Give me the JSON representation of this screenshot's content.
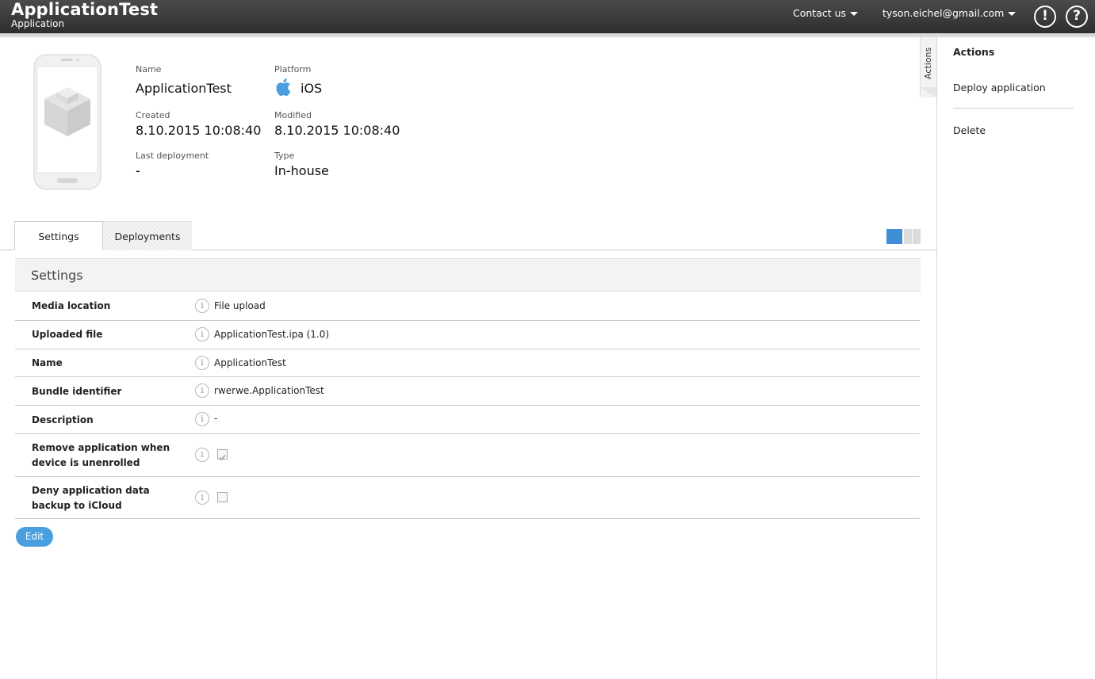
{
  "header": {
    "title": "ApplicationTest",
    "subtitle": "Application",
    "contact_label": "Contact us",
    "user_email": "tyson.eichel@gmail.com",
    "alert_symbol": "!",
    "help_symbol": "?"
  },
  "app_info": {
    "name_label": "Name",
    "name_value": "ApplicationTest",
    "platform_label": "Platform",
    "platform_value": "iOS",
    "platform_icon": "apple-icon",
    "created_label": "Created",
    "created_value": "8.10.2015 10:08:40",
    "modified_label": "Modified",
    "modified_value": "8.10.2015 10:08:40",
    "last_deployment_label": "Last deployment",
    "last_deployment_value": "-",
    "type_label": "Type",
    "type_value": "In-house"
  },
  "tabs": [
    {
      "label": "Settings",
      "active": true
    },
    {
      "label": "Deployments",
      "active": false
    }
  ],
  "settings": {
    "title": "Settings",
    "rows": [
      {
        "label": "Media location",
        "value": "File upload"
      },
      {
        "label": "Uploaded file",
        "value": "ApplicationTest.ipa (1.0)"
      },
      {
        "label": "Name",
        "value": "ApplicationTest"
      },
      {
        "label": "Bundle identifier",
        "value": "rwerwe.ApplicationTest"
      },
      {
        "label": "Description",
        "value": "-"
      },
      {
        "label": "Remove application when device is unenrolled",
        "checked": true
      },
      {
        "label": "Deny application data backup to iCloud",
        "checked": false
      }
    ],
    "edit_label": "Edit"
  },
  "actions_panel": {
    "tab_label": "Actions",
    "title": "Actions",
    "items": [
      "Deploy application",
      "Delete"
    ]
  },
  "colors": {
    "accent": "#4a9fe0",
    "topbar": "#333333"
  }
}
